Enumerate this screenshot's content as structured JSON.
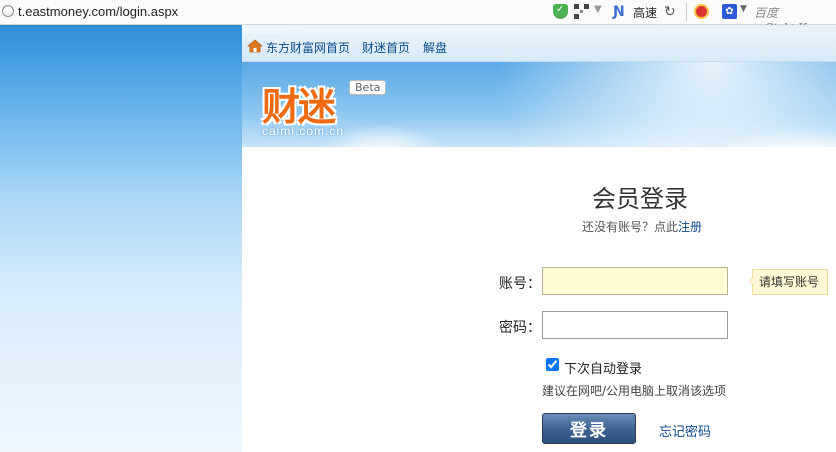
{
  "browser": {
    "url": "t.eastmoney.com/login.aspx",
    "speed_label": "高速",
    "search_placeholder": "百度 <Ctrl+K>"
  },
  "nav": {
    "items": [
      "东方财富网首页",
      "财迷首页",
      "解盘"
    ]
  },
  "banner": {
    "logo_text": "财迷",
    "beta": "Beta",
    "domain": "caimi.com.cn"
  },
  "login": {
    "title": "会员登录",
    "no_account_text": "还没有账号？点此",
    "register_link": "注册",
    "account_label": "账号：",
    "password_label": "密码：",
    "account_tip": "请填写账号",
    "auto_login_label": "下次自动登录",
    "auto_login_checked": true,
    "hint": "建议在网吧/公用电脑上取消该选项",
    "submit": "登录",
    "forgot": "忘记密码"
  },
  "colors": {
    "link": "#0b4a8a",
    "logo": "#f06a12",
    "button": "#3f6594",
    "input_highlight": "#fffbd3"
  }
}
